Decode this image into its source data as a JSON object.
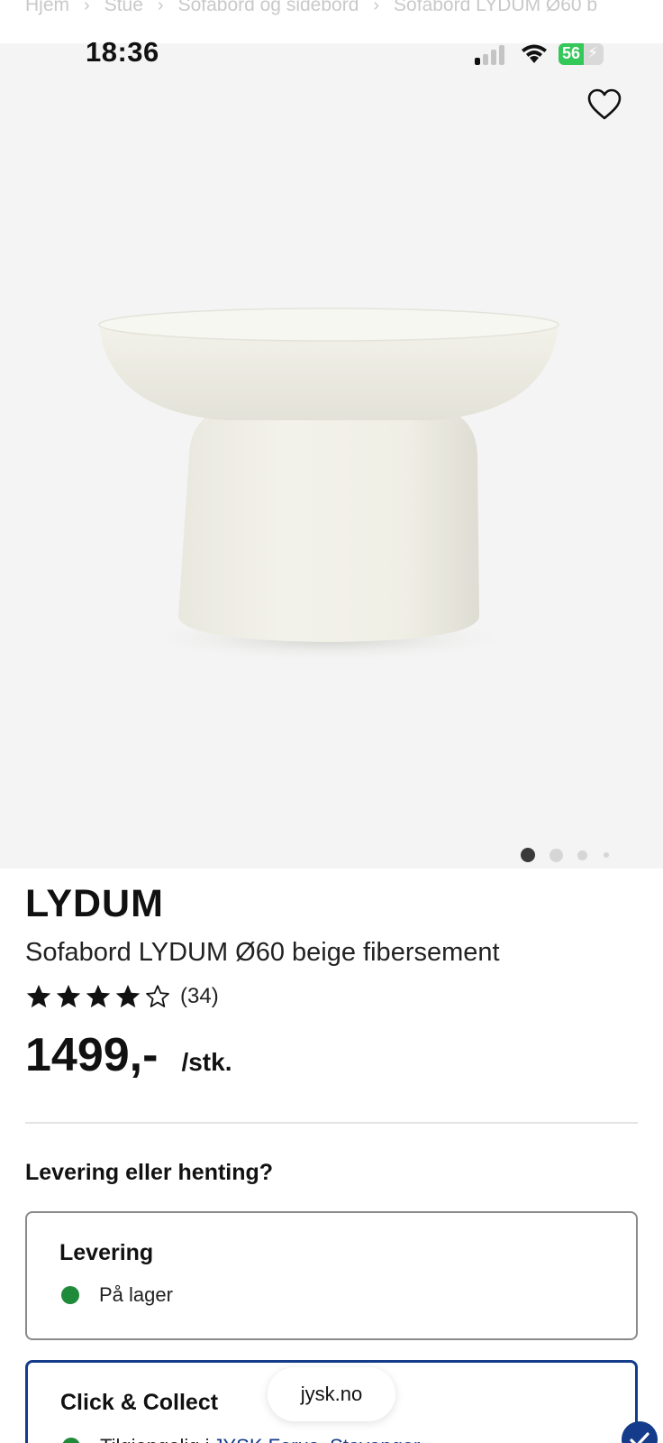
{
  "breadcrumb": {
    "items": [
      "Hjem",
      "Stue",
      "Sofabord og sidebord",
      "Sofabord LYDUM Ø60 b"
    ]
  },
  "status_bar": {
    "time": "18:36",
    "battery_percent": "56",
    "battery_level": 0.56,
    "signal_bars_active": 1,
    "icons": [
      "cellular-signal-icon",
      "wifi-icon",
      "battery-charging-icon"
    ]
  },
  "gallery": {
    "favorite_icon": "heart-outline-icon",
    "image_count": 4,
    "active_index": 0
  },
  "product": {
    "brand": "LYDUM",
    "name": "Sofabord LYDUM Ø60 beige fibersement",
    "rating": 4,
    "rating_max": 5,
    "reviews": "(34)",
    "price": "1499,-",
    "unit": "/stk."
  },
  "fulfillment": {
    "title": "Levering eller henting?",
    "delivery": {
      "title": "Levering",
      "status": "På lager"
    },
    "click_collect": {
      "title": "Click & Collect",
      "availability_prefix": "Tilgjengelig i",
      "store_link": "JYSK Forus, Stavanger"
    }
  },
  "browser": {
    "url": "jysk.no"
  },
  "colors": {
    "brand_blue": "#143c8a",
    "stock_green": "#1f8a3a",
    "gallery_bg": "#f4f4f4"
  }
}
